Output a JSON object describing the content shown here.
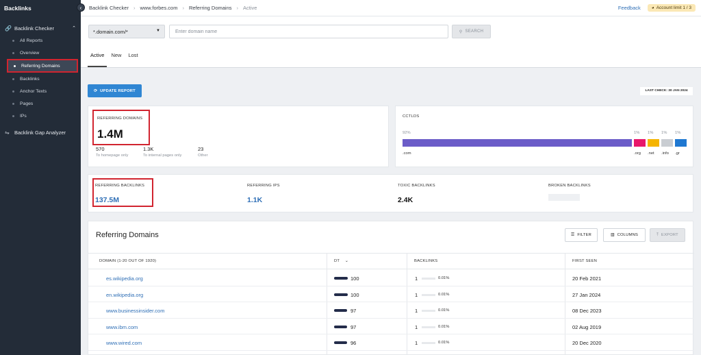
{
  "sidebar": {
    "brand": "Backlinks",
    "sections": [
      {
        "label": "Backlink Checker",
        "icon": "link-icon"
      },
      {
        "label": "Backlink Gap Analyzer",
        "icon": "gap-analyzer-icon"
      }
    ],
    "items": [
      "All Reports",
      "Overview",
      "Referring Domains",
      "Backlinks",
      "Anchor Texts",
      "Pages",
      "IPs"
    ],
    "active_item": "Referring Domains"
  },
  "topbar": {
    "breadcrumb": [
      "Backlink Checker",
      "www.forbes.com",
      "Referring Domains",
      "Active"
    ],
    "feedback": "Feedback",
    "account_limit": "Account limit 1 / 3"
  },
  "search": {
    "scope": "*.domain.com/*",
    "placeholder": "Enter domain name",
    "button": "SEARCH"
  },
  "tabs": [
    "Active",
    "New",
    "Lost"
  ],
  "update_button": "UPDATE REPORT",
  "last_check": "LAST CHECK: 30 JAN 2024",
  "referring_domains": {
    "title": "REFERRING DOMAINS",
    "value": "1.4M",
    "breakdown": [
      {
        "value": "570",
        "desc": "To homepage only"
      },
      {
        "value": "1.3K",
        "desc": "To internal pages only"
      },
      {
        "value": "23",
        "desc": "Other"
      }
    ]
  },
  "cctlds": {
    "title": "CCTLDS",
    "segments": [
      {
        "label": ".com",
        "pct": "92%",
        "share": 92,
        "color": "#6b5cc8"
      },
      {
        "label": ".org",
        "pct": "1%",
        "share": 1,
        "color": "#e8176b"
      },
      {
        "label": ".net",
        "pct": "1%",
        "share": 1,
        "color": "#f5b400"
      },
      {
        "label": ".info",
        "pct": "1%",
        "share": 1,
        "color": "#c9cdd2"
      },
      {
        "label": ".gr",
        "pct": "1%",
        "share": 1,
        "color": "#1f78d1"
      }
    ]
  },
  "metrics": [
    {
      "title": "REFERRING BACKLINKS",
      "value": "137.5M"
    },
    {
      "title": "REFERRING IPS",
      "value": "1.1K"
    },
    {
      "title": "TOXIC BACKLINKS",
      "value": "2.4K"
    },
    {
      "title": "BROKEN BACKLINKS",
      "value": ""
    }
  ],
  "table": {
    "title": "Referring Domains",
    "buttons": {
      "filter": "FILTER",
      "columns": "COLUMNS",
      "export": "EXPORT"
    },
    "headers": {
      "domain": "DOMAIN (1-20 OUT OF 1920)",
      "dt": "DT",
      "backlinks": "BACKLINKS",
      "first_seen": "FIRST SEEN"
    },
    "rows": [
      {
        "domain": "es.wikipedia.org",
        "dt": "100",
        "dt_fraction": 1.0,
        "backlinks": "1",
        "share": "0.01%",
        "first_seen": "20 Feb 2021"
      },
      {
        "domain": "en.wikipedia.org",
        "dt": "100",
        "dt_fraction": 1.0,
        "backlinks": "1",
        "share": "0.01%",
        "first_seen": "27 Jan 2024"
      },
      {
        "domain": "www.businessinsider.com",
        "dt": "97",
        "dt_fraction": 0.97,
        "backlinks": "1",
        "share": "0.01%",
        "first_seen": "08 Dec 2023"
      },
      {
        "domain": "www.ibm.com",
        "dt": "97",
        "dt_fraction": 0.97,
        "backlinks": "1",
        "share": "0.01%",
        "first_seen": "02 Aug 2019"
      },
      {
        "domain": "www.wired.com",
        "dt": "96",
        "dt_fraction": 0.96,
        "backlinks": "1",
        "share": "0.01%",
        "first_seen": "20 Dec 2020"
      }
    ]
  }
}
